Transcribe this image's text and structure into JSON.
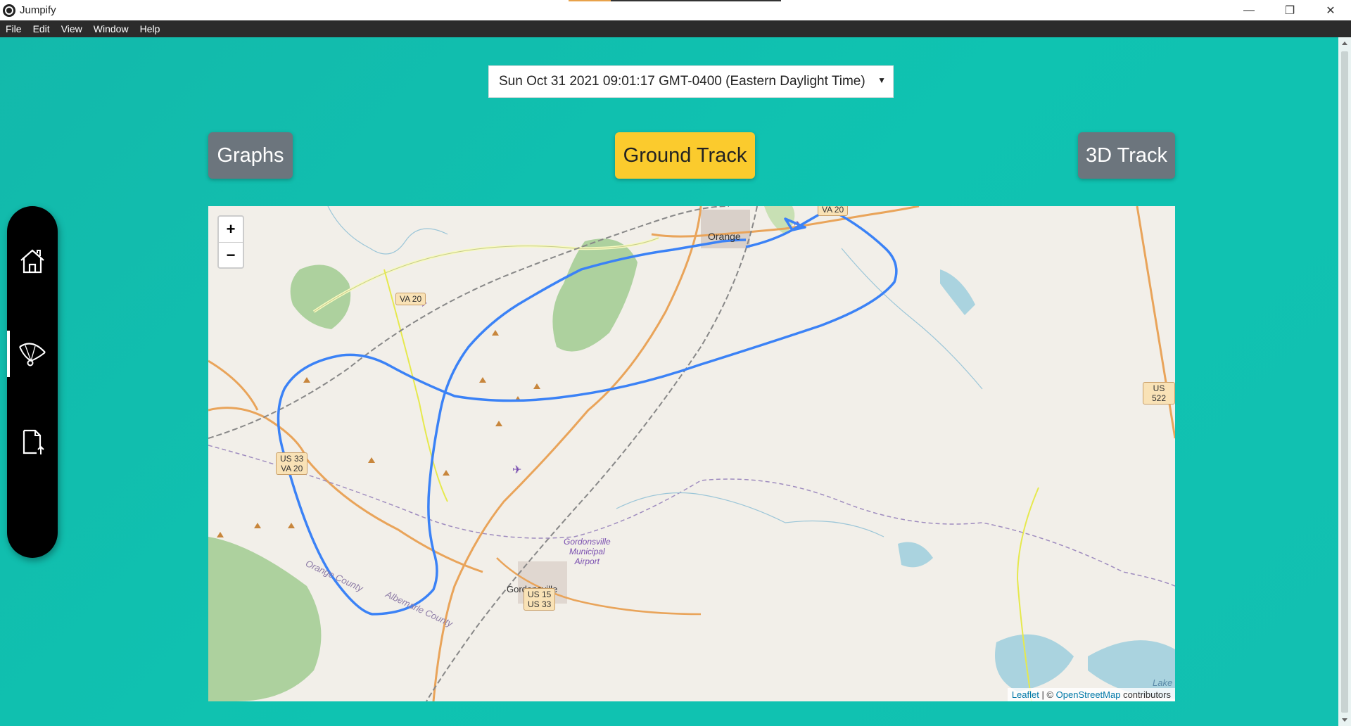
{
  "window": {
    "title": "Jumpify",
    "controls": {
      "minimize": "—",
      "maximize": "❐",
      "close": "✕"
    }
  },
  "menu": [
    "File",
    "Edit",
    "View",
    "Window",
    "Help"
  ],
  "date_selector": {
    "value": "Sun Oct 31 2021 09:01:17 GMT-0400 (Eastern Daylight Time)",
    "caret": "▼"
  },
  "nav_buttons": {
    "graphs": "Graphs",
    "ground_track": "Ground Track",
    "track_3d": "3D Track"
  },
  "colors": {
    "active_button": "#fbcb2d",
    "inactive_button": "#6c757d",
    "track_line": "#3b82f6"
  },
  "sidebar": {
    "items": [
      {
        "icon": "home-icon",
        "active": false
      },
      {
        "icon": "paraglider-icon",
        "active": true
      },
      {
        "icon": "file-upload-icon",
        "active": false
      }
    ]
  },
  "map": {
    "zoom_in": "+",
    "zoom_out": "−",
    "attribution": {
      "leaflet": "Leaflet",
      "separator": " | © ",
      "osm": "OpenStreetMap",
      "suffix": " contributors"
    },
    "places": {
      "orange": "Orange",
      "gordonsville": "Gordonsville",
      "airport_line1": "Gordonsville",
      "airport_line2": "Municipal",
      "airport_line3": "Airport",
      "orange_county": "Orange County",
      "albemarle_county": "Albemarle County",
      "lake": "Lake"
    },
    "shields": {
      "va20_top": "VA 20",
      "va20_left": "VA 20",
      "us33_line1": "US 33",
      "us33_line2": "VA 20",
      "us15_line1": "US 15",
      "us15_line2": "US 33",
      "us522": "US 522"
    }
  }
}
